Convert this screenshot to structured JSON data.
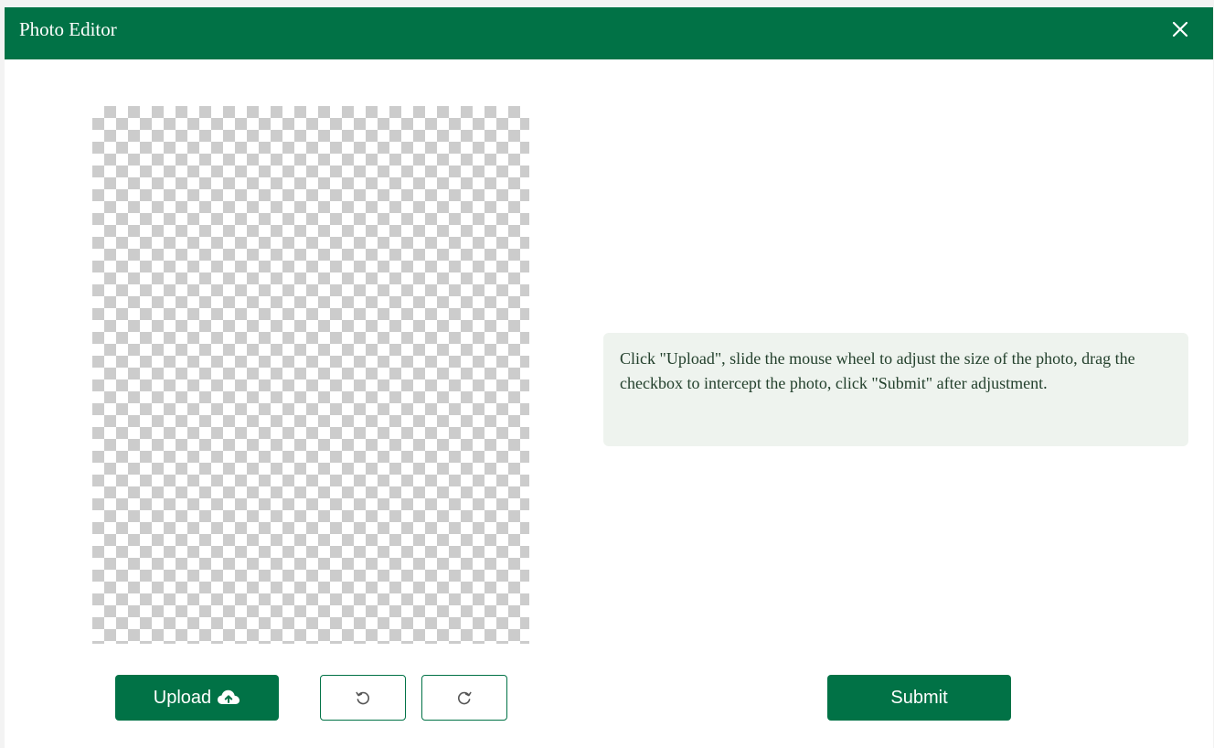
{
  "dialog": {
    "title": "Photo Editor",
    "close_icon": "close-icon"
  },
  "hint": {
    "text": "Click \"Upload\", slide the mouse wheel to adjust the size of the photo, drag the checkbox to intercept the photo, click \"Submit\" after adjustment."
  },
  "toolbar": {
    "upload_label": "Upload",
    "upload_icon": "cloud-upload-icon",
    "rotate_left_icon": "rotate-left-icon",
    "rotate_right_icon": "rotate-right-icon",
    "submit_label": "Submit"
  },
  "colors": {
    "brand": "#017246",
    "hint_background": "#eef3ee",
    "checker": "#cccccc"
  }
}
